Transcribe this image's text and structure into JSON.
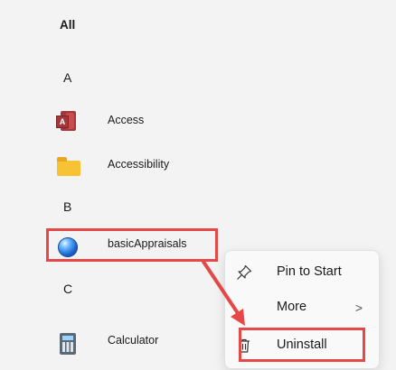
{
  "start_menu": {
    "all_label": "All",
    "sections": [
      {
        "letter": "A"
      },
      {
        "letter": "B"
      },
      {
        "letter": "C"
      }
    ],
    "apps": [
      {
        "label": "Access",
        "icon": "access-icon"
      },
      {
        "label": "Accessibility",
        "icon": "folder-icon"
      },
      {
        "label": "basicAppraisals",
        "icon": "globe-icon"
      },
      {
        "label": "Calculator",
        "icon": "calculator-icon"
      }
    ]
  },
  "context_menu": {
    "items": [
      {
        "label": "Pin to Start",
        "icon": "pin-icon"
      },
      {
        "label": "More",
        "icon": "",
        "chevron": ">"
      },
      {
        "label": "Uninstall",
        "icon": "trash-icon"
      }
    ]
  },
  "colors": {
    "highlight": "#e64747",
    "background": "#f3f3f3"
  }
}
